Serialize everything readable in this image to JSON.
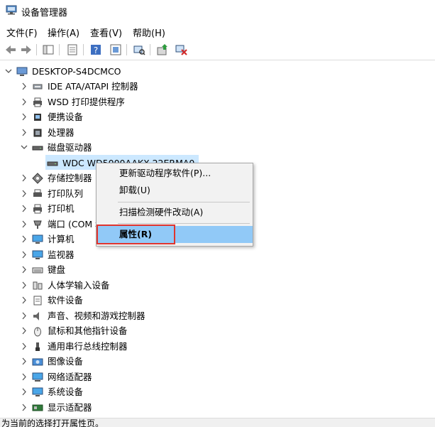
{
  "window": {
    "title": "设备管理器",
    "icon": "device-manager-icon"
  },
  "menubar": {
    "items": [
      "文件(F)",
      "操作(A)",
      "查看(V)",
      "帮助(H)"
    ]
  },
  "toolbar": {
    "buttons": [
      "back-icon",
      "forward-icon",
      "show-hide-console-tree-icon",
      "properties-icon",
      "help-icon",
      "scan-hardware-icon",
      "update-driver-icon",
      "uninstall-device-icon"
    ]
  },
  "tree": {
    "root": "DESKTOP-S4DCMCO",
    "nodes": [
      {
        "label": "IDE ATA/ATAPI 控制器",
        "icon": "ide-controller-icon"
      },
      {
        "label": "WSD 打印提供程序",
        "icon": "wsd-printer-icon"
      },
      {
        "label": "便携设备",
        "icon": "portable-device-icon"
      },
      {
        "label": "处理器",
        "icon": "processor-icon"
      },
      {
        "label": "磁盘驱动器",
        "icon": "disk-drive-icon",
        "expanded": true
      },
      {
        "label": "WDC WD5000AAKX-22ERMA0",
        "icon": "disk-icon",
        "child": true,
        "selected": true
      },
      {
        "label": "存储控制器",
        "icon": "storage-controller-icon"
      },
      {
        "label": "打印队列",
        "icon": "print-queue-icon"
      },
      {
        "label": "打印机",
        "icon": "printer-icon"
      },
      {
        "label": "端口 (COM 和 LPT)",
        "icon": "port-icon"
      },
      {
        "label": "计算机",
        "icon": "computer-icon"
      },
      {
        "label": "监视器",
        "icon": "monitor-icon"
      },
      {
        "label": "键盘",
        "icon": "keyboard-icon"
      },
      {
        "label": "人体学输入设备",
        "icon": "hid-icon"
      },
      {
        "label": "软件设备",
        "icon": "software-device-icon"
      },
      {
        "label": "声音、视频和游戏控制器",
        "icon": "sound-icon"
      },
      {
        "label": "鼠标和其他指针设备",
        "icon": "mouse-icon"
      },
      {
        "label": "通用串行总线控制器",
        "icon": "usb-icon"
      },
      {
        "label": "图像设备",
        "icon": "imaging-device-icon"
      },
      {
        "label": "网络适配器",
        "icon": "network-adapter-icon"
      },
      {
        "label": "系统设备",
        "icon": "system-device-icon"
      },
      {
        "label": "显示适配器",
        "icon": "display-adapter-icon"
      }
    ]
  },
  "context_menu": {
    "items": [
      "更新驱动程序软件(P)...",
      "卸载(U)",
      "扫描检测硬件改动(A)",
      "属性(R)"
    ],
    "highlighted": "属性(R)"
  },
  "statusbar": {
    "text": "为当前的选择打开属性页。"
  },
  "colors": {
    "selection": "#cce8ff",
    "menu_highlight": "#91c9f7",
    "annotation_box": "#e0342e"
  }
}
